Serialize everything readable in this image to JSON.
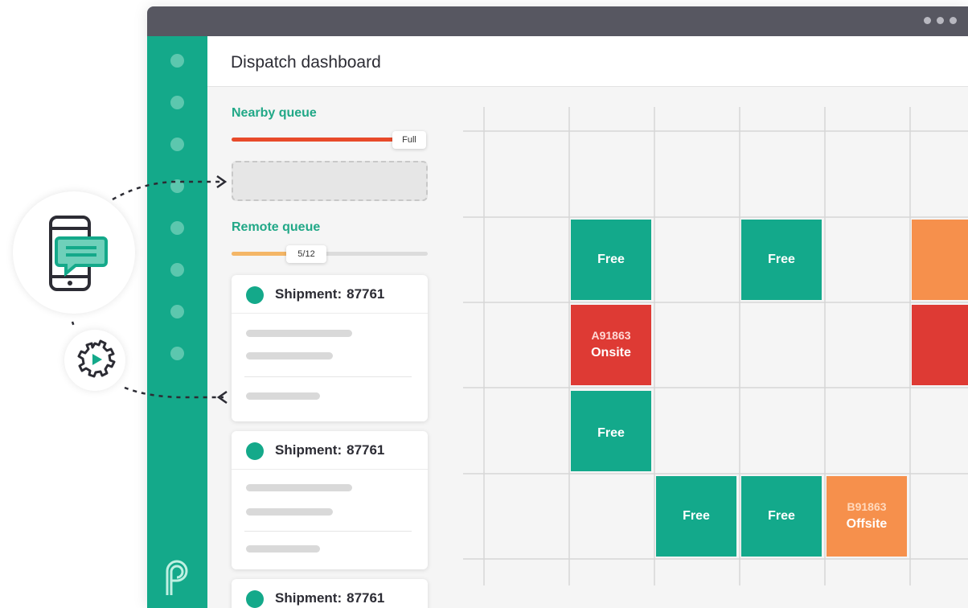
{
  "app": {
    "title": "Dispatch dashboard"
  },
  "colors": {
    "brand_green": "#14a98a",
    "free": "#13a98b",
    "onsite": "#de3a34",
    "offsite": "#f6904c",
    "full_bar": "#e84a2a",
    "remote_bar": "#f4b667"
  },
  "nearby_queue": {
    "title": "Nearby queue",
    "status": "Full"
  },
  "remote_queue": {
    "title": "Remote queue",
    "progress_label": "5/12",
    "progress_fraction": 0.4167
  },
  "shipments": [
    {
      "label": "Shipment:",
      "id": "87761"
    },
    {
      "label": "Shipment:",
      "id": "87761"
    },
    {
      "label": "Shipment:",
      "id": "87761"
    }
  ],
  "grid_cells": {
    "r1c2": {
      "label": "Free"
    },
    "r1c4": {
      "label": "Free"
    },
    "r2c2": {
      "id": "A91863",
      "status": "Onsite"
    },
    "r3c2": {
      "label": "Free"
    },
    "r4c3": {
      "label": "Free"
    },
    "r4c4": {
      "label": "Free"
    },
    "r4c5": {
      "id": "B91863",
      "status": "Offsite"
    }
  },
  "icons": {
    "phone": "mobile-message-icon",
    "gear": "gear-play-icon",
    "logo": "p-logo-icon"
  }
}
